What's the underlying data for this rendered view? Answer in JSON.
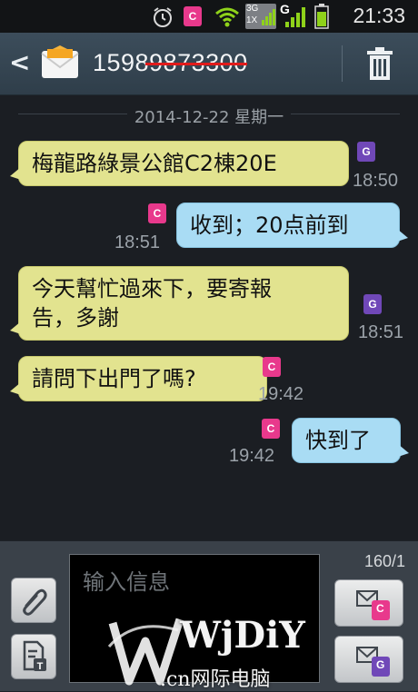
{
  "status_bar": {
    "time": "21:33",
    "network_label": "3G",
    "network_sub": "1X",
    "network_g": "G",
    "sim_badge": "C",
    "icons": [
      "alarm-icon",
      "sim-c-icon",
      "wifi-icon",
      "signal-3g-icon",
      "signal-g-icon",
      "battery-icon"
    ]
  },
  "header": {
    "contact_number": "15989873300",
    "icons": [
      "back-arrow-icon",
      "envelope-icon",
      "trash-icon"
    ]
  },
  "conversation": {
    "date_divider": "2014-12-22 星期一",
    "messages": [
      {
        "direction": "in",
        "text": "梅龍路綠景公館C2棟20E",
        "time": "18:50",
        "sim": "G"
      },
      {
        "direction": "out",
        "text": "收到；20点前到",
        "time": "18:51",
        "sim": "C"
      },
      {
        "direction": "in",
        "text_line1": "今天幫忙過來下，要寄報",
        "text_line2": "告，多謝",
        "time": "18:51",
        "sim": "G"
      },
      {
        "direction": "in",
        "text": "請問下出門了嗎?",
        "time": "19:42",
        "sim": "C"
      },
      {
        "direction": "out",
        "text": "快到了",
        "time": "19:42",
        "sim": "C"
      }
    ]
  },
  "composer": {
    "placeholder": "输入信息",
    "counter": "160/1",
    "send_c_label": "C",
    "send_g_label": "G",
    "icons": [
      "attach-icon",
      "template-icon",
      "send-sim-c-icon",
      "send-sim-g-icon"
    ]
  },
  "watermark": {
    "brand": "WjDiY",
    "sub": ".cn网际电脑"
  },
  "colors": {
    "incoming_bubble": "#e2e38f",
    "outgoing_bubble": "#a9dcf4",
    "sim_c": "#e8398c",
    "sim_g": "#7048b8",
    "header": "#3c4d5b"
  }
}
